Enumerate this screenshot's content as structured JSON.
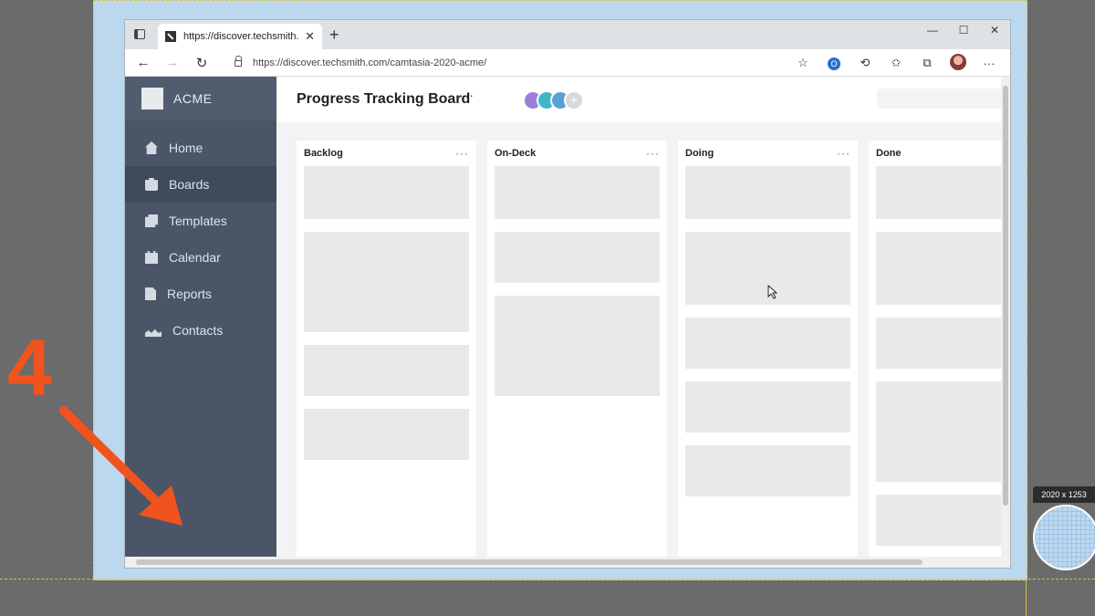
{
  "browser": {
    "tab_title": "https://discover.techsmith.com/c",
    "tab_close": "✕",
    "new_tab": "+",
    "window_controls": [
      "—",
      "☐",
      "✕"
    ],
    "url": "https://discover.techsmith.com/camtasia-2020-acme/",
    "nav": {
      "back": "←",
      "forward": "→",
      "reload": "↻"
    },
    "tools": [
      "☆",
      "",
      "⟲",
      "✩",
      "⧉",
      "",
      "···"
    ]
  },
  "app": {
    "brand": "ACME",
    "sidebar": {
      "items": [
        {
          "label": "Home",
          "icon": "home-icon",
          "active": false
        },
        {
          "label": "Boards",
          "icon": "boards-icon",
          "active": true
        },
        {
          "label": "Templates",
          "icon": "templates-icon",
          "active": false
        },
        {
          "label": "Calendar",
          "icon": "calendar-icon",
          "active": false
        },
        {
          "label": "Reports",
          "icon": "reports-icon",
          "active": false
        },
        {
          "label": "Contacts",
          "icon": "contacts-icon",
          "active": false
        }
      ]
    },
    "board": {
      "title": "Progress Tracking Board",
      "menu": "···",
      "add_member": "+",
      "columns": [
        {
          "name": "Backlog",
          "menu": "···"
        },
        {
          "name": "On-Deck",
          "menu": "···"
        },
        {
          "name": "Doing",
          "menu": "···"
        },
        {
          "name": "Done",
          "menu": "···"
        }
      ]
    }
  },
  "overlay": {
    "step_number": "4",
    "arrow_color": "#f0531d",
    "dimensions": "2020 x 1253"
  }
}
